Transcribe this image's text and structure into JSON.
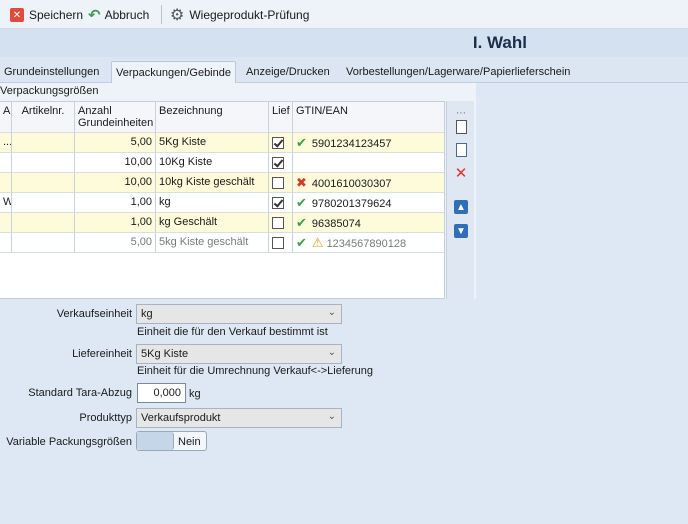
{
  "toolbar": {
    "save_label": "Speichern",
    "cancel_label": "Abbruch",
    "weigh_label": "Wiegeprodukt-Prüfung"
  },
  "header": {
    "title": "I. Wahl"
  },
  "tabs": [
    {
      "label": "Grundeinstellungen",
      "active": false
    },
    {
      "label": "Verpackungen/Gebinde",
      "active": true
    },
    {
      "label": "Anzeige/Drucken",
      "active": false
    },
    {
      "label": "Vorbestellungen/Lagerware/Papierlieferschein",
      "active": false
    }
  ],
  "grid": {
    "title": "Verpackungsgrößen",
    "columns": {
      "a": "A",
      "artikelnr": "Artikelnr.",
      "anzahl": "Anzahl Grundeinheiten",
      "bezeichnung": "Bezeichnung",
      "lief": "Lief",
      "gtin": "GTIN/EAN"
    },
    "rows": [
      {
        "a": "...",
        "anzahl": "5,00",
        "bezeichnung": "5Kg Kiste",
        "lief": true,
        "gtin": "5901234123457",
        "status": "ok"
      },
      {
        "a": "",
        "anzahl": "10,00",
        "bezeichnung": "10Kg Kiste",
        "lief": true,
        "gtin": "",
        "status": "none"
      },
      {
        "a": "",
        "anzahl": "10,00",
        "bezeichnung": "10kg Kiste geschält",
        "lief": false,
        "gtin": "4001610030307",
        "status": "error"
      },
      {
        "a": "W",
        "anzahl": "1,00",
        "bezeichnung": "kg",
        "lief": true,
        "gtin": "9780201379624",
        "status": "ok"
      },
      {
        "a": "",
        "anzahl": "1,00",
        "bezeichnung": "kg Geschält",
        "lief": false,
        "gtin": "96385074",
        "status": "ok"
      },
      {
        "a": "",
        "anzahl": "5,00",
        "bezeichnung": "5kg Kiste geschält",
        "lief": false,
        "gtin": "1234567890128",
        "status": "warn"
      }
    ]
  },
  "form": {
    "verkaufseinheit": {
      "label": "Verkaufseinheit",
      "value": "kg",
      "hint": "Einheit die für den Verkauf bestimmt ist"
    },
    "liefereinheit": {
      "label": "Liefereinheit",
      "value": "5Kg Kiste",
      "hint": "Einheit für die Umrechnung Verkauf<->Lieferung"
    },
    "tara": {
      "label": "Standard Tara-Abzug",
      "value": "0,000",
      "unit": "kg"
    },
    "produkttyp": {
      "label": "Produkttyp",
      "value": "Verkaufsprodukt"
    },
    "variable": {
      "label": "Variable Packungsgrößen",
      "value": "Nein"
    }
  },
  "colors": {
    "accent": "#2f6fb8",
    "row_highlight": "#fdfbd9",
    "ok": "#3aa04a",
    "error": "#d9372b",
    "warn": "#e0a21a"
  }
}
